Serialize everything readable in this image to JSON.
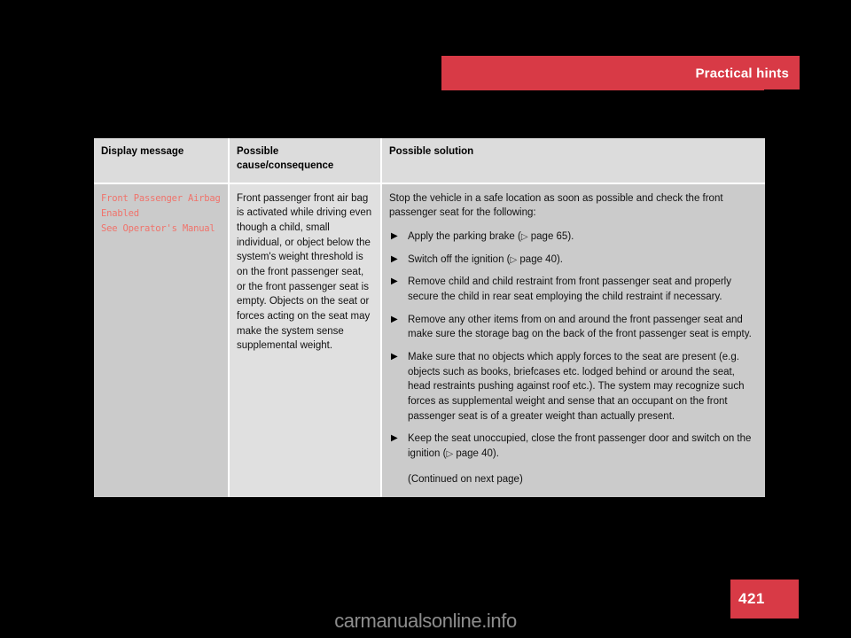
{
  "banner": {
    "title": "Practical hints",
    "color": "#d83a46"
  },
  "page_number": "421",
  "watermark": "carmanualsonline.info",
  "table": {
    "headers": {
      "display_message": "Display message",
      "possible_cause": "Possible\ncause/consequence",
      "possible_solution": "Possible solution"
    },
    "row": {
      "display_message": "Front Passenger Airbag\nEnabled\nSee Operator's Manual",
      "display_message_color": "#f0736b",
      "cause": "Front passenger front air bag is activated while driving even though a child, small individual, or object below the system's weight threshold is on the front passenger seat, or the front passenger seat is empty. Objects on the seat or forces acting on the seat may make the system sense supplemental weight.",
      "solution_intro": "Stop the vehicle in a safe location as soon as possible and check the front passenger seat for the following:",
      "solution_bullets": [
        "Apply the parking brake (▷ page 65).",
        "Switch off the ignition (▷ page 40).",
        "Remove child and child restraint from front passenger seat and properly secure the child in rear seat employing the child restraint if necessary.",
        "Remove any other items from on and around the front passenger seat and make sure the storage bag on the back of the front passenger seat is empty.",
        "Make sure that no objects which apply forces to the seat are present (e.g. objects such as books, briefcases etc. lodged behind or around the seat, head restraints pushing against roof etc.). The system may recognize such forces as supplemental weight and sense that an occupant on the front passenger seat is of a greater weight than actually present.",
        "Keep the seat unoccupied, close the front passenger door and switch on the ignition (▷ page 40)."
      ],
      "bullet_glyph": "▶",
      "continued_note": "(Continued on next page)"
    }
  }
}
